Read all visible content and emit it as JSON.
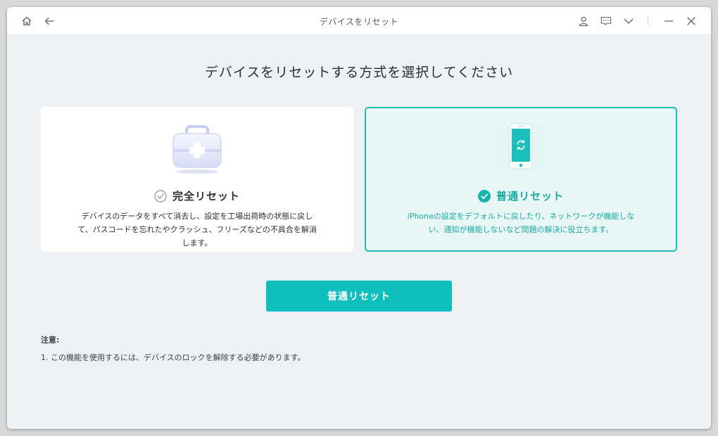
{
  "window": {
    "title": "デバイスをリセット",
    "icons": [
      "home-icon",
      "back-arrow-icon",
      "user-icon",
      "feedback-icon",
      "chevron-down-icon",
      "minimize-icon",
      "close-icon"
    ]
  },
  "main": {
    "heading": "デバイスをリセットする方式を選択してください",
    "options": [
      {
        "title": "完全リセット",
        "description": "デバイスのデータをすべて消去し、設定を工場出荷時の状態に戻して、パスコードを忘れたやクラッシュ、フリーズなどの不具合を解消します。",
        "selected": false,
        "icon": "toolbox-icon"
      },
      {
        "title": "普通リセット",
        "description": "iPhoneの設定をデフォルトに戻したり、ネットワークが機能しない、通知が機能しないなど問題の解決に役立ちます。",
        "selected": true,
        "icon": "phone-refresh-icon"
      }
    ],
    "action_button": "普通リセット"
  },
  "notes": {
    "title": "注意:",
    "items": [
      "1. この機能を使用するには、デバイスのロックを解除する必要があります。"
    ]
  },
  "colors": {
    "accent": "#0fbfbd",
    "selected_border": "#1cbdb8",
    "selected_bg": "#e8f7f6",
    "background": "#edf1f4"
  }
}
